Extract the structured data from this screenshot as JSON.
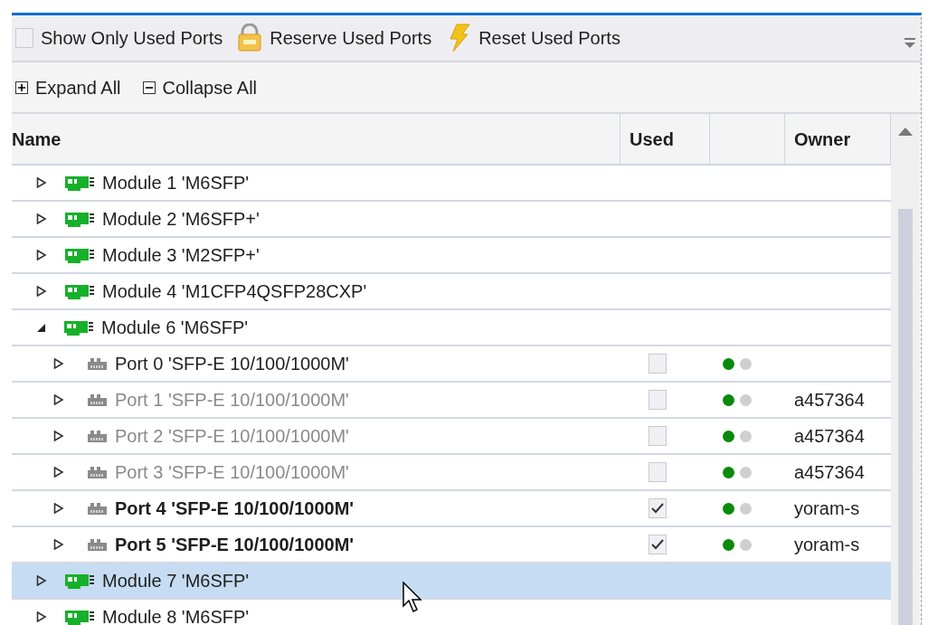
{
  "toolbar": {
    "show_only_used": {
      "label": "Show Only Used Ports",
      "checked": false
    },
    "buttons": [
      {
        "kind": "reserve",
        "label": "Reserve Used Ports"
      },
      {
        "kind": "reset",
        "label": "Reset Used Ports"
      }
    ]
  },
  "tree_actions": [
    {
      "kind": "expand",
      "label": "Expand All"
    },
    {
      "kind": "collapse",
      "label": "Collapse All"
    }
  ],
  "table": {
    "columns": [
      "Name",
      "Used",
      "Owner"
    ],
    "rows": [
      {
        "label": "Module 1 'M6SFP'",
        "expanded": false,
        "selected": false
      },
      {
        "label": "Module 2 'M6SFP+'",
        "expanded": false,
        "selected": false
      },
      {
        "label": "Module 3 'M2SFP+'",
        "expanded": false,
        "selected": false
      },
      {
        "label": "Module 4 'M1CFP4QSFP28CXP'",
        "expanded": false,
        "selected": false
      },
      {
        "label": "Module 6 'M6SFP'",
        "expanded": true,
        "selected": false,
        "children": [
          {
            "label": "Port 0 'SFP-E 10/100/1000M'",
            "expanded": false,
            "selected": false,
            "dimmed": false,
            "bold": false,
            "used": false,
            "leds": [
              {
                "on": true
              },
              {
                "on": false
              }
            ]
          },
          {
            "label": "Port 1 'SFP-E 10/100/1000M'",
            "expanded": false,
            "selected": false,
            "dimmed": true,
            "bold": false,
            "used": false,
            "leds": [
              {
                "on": true
              },
              {
                "on": false
              }
            ],
            "owner": "a457364"
          },
          {
            "label": "Port 2 'SFP-E 10/100/1000M'",
            "expanded": false,
            "selected": false,
            "dimmed": true,
            "bold": false,
            "used": false,
            "leds": [
              {
                "on": true
              },
              {
                "on": false
              }
            ],
            "owner": "a457364"
          },
          {
            "label": "Port 3 'SFP-E 10/100/1000M'",
            "expanded": false,
            "selected": false,
            "dimmed": true,
            "bold": false,
            "used": false,
            "leds": [
              {
                "on": true
              },
              {
                "on": false
              }
            ],
            "owner": "a457364"
          },
          {
            "label": "Port 4 'SFP-E 10/100/1000M'",
            "expanded": false,
            "selected": false,
            "dimmed": false,
            "bold": true,
            "used": true,
            "leds": [
              {
                "on": true
              },
              {
                "on": false
              }
            ],
            "owner": "yoram-s"
          },
          {
            "label": "Port 5 'SFP-E 10/100/1000M'",
            "expanded": false,
            "selected": false,
            "dimmed": false,
            "bold": true,
            "used": true,
            "leds": [
              {
                "on": true
              },
              {
                "on": false
              }
            ],
            "owner": "yoram-s"
          }
        ]
      },
      {
        "label": "Module 7 'M6SFP'",
        "expanded": false,
        "selected": true
      },
      {
        "label": "Module 8 'M6SFP'",
        "expanded": false,
        "selected": false
      }
    ]
  }
}
